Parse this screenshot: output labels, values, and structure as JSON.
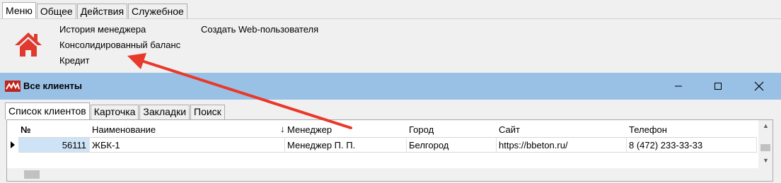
{
  "top_tabs": [
    "Меню",
    "Общее",
    "Действия",
    "Служебное"
  ],
  "ribbon": {
    "links": [
      "История менеджера",
      "Консолидированный баланс",
      "Кредит",
      "Создать Web-пользователя"
    ],
    "home_icon": "home-icon"
  },
  "window": {
    "title": "Все клиенты",
    "tabs": [
      "Список клиентов",
      "Карточка",
      "Закладки",
      "Поиск"
    ],
    "columns": [
      "№",
      "Наименование",
      "Менеджер",
      "Город",
      "Сайт",
      "Телефон"
    ],
    "rows": [
      [
        "56111",
        "ЖБК-1",
        "Менеджер П. П.",
        "Белгород",
        "https://bbeton.ru/",
        "8 (472) 233-33-33"
      ]
    ]
  },
  "colors": {
    "titlebar": "#99c1e6",
    "annotation_arrow": "#e8392b",
    "home_icon": "#e03a2f"
  }
}
